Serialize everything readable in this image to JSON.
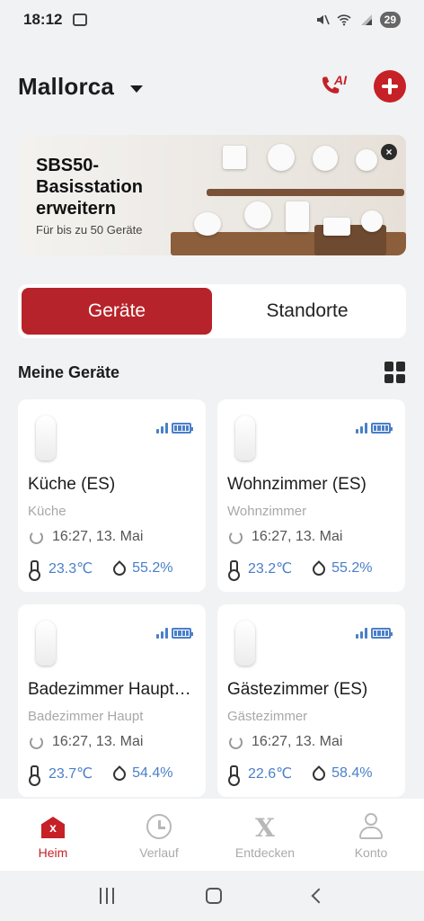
{
  "status_bar": {
    "time": "18:12",
    "battery": "29"
  },
  "header": {
    "location": "Mallorca",
    "ai_label": "AI"
  },
  "banner": {
    "title": "SBS50-Basisstation erweitern",
    "subtitle": "Für bis zu 50 Geräte",
    "close_label": "×"
  },
  "tabs": [
    {
      "label": "Geräte",
      "active": true
    },
    {
      "label": "Standorte",
      "active": false
    }
  ],
  "section": {
    "title": "Meine Geräte"
  },
  "devices": [
    {
      "name": "Küche (ES)",
      "location": "Küche",
      "updated": "16:27, 13. Mai",
      "temperature": "23.3℃",
      "humidity": "55.2%"
    },
    {
      "name": "Wohnzimmer (ES)",
      "location": "Wohnzimmer",
      "updated": "16:27, 13. Mai",
      "temperature": "23.2℃",
      "humidity": "55.2%"
    },
    {
      "name": "Badezimmer Haupt…",
      "location": "Badezimmer Haupt",
      "updated": "16:27, 13. Mai",
      "temperature": "23.7℃",
      "humidity": "54.4%"
    },
    {
      "name": "Gästezimmer (ES)",
      "location": "Gästezimmer",
      "updated": "16:27, 13. Mai",
      "temperature": "22.6℃",
      "humidity": "58.4%"
    }
  ],
  "bottom_nav": [
    {
      "label": "Heim",
      "icon": "home-icon",
      "active": true
    },
    {
      "label": "Verlauf",
      "icon": "clock-icon",
      "active": false
    },
    {
      "label": "Entdecken",
      "icon": "x-icon",
      "active": false
    },
    {
      "label": "Konto",
      "icon": "user-icon",
      "active": false
    }
  ],
  "colors": {
    "brand_red": "#c52127",
    "accent_blue": "#4a7fc8",
    "background": "#f1f2f4"
  }
}
